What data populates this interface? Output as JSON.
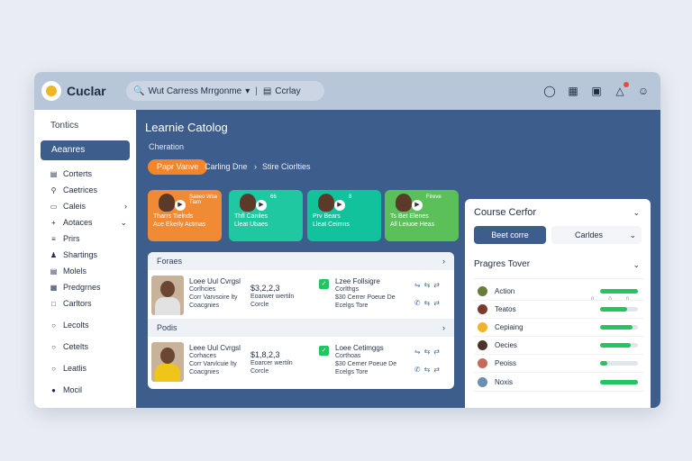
{
  "app": {
    "name": "Cuclar"
  },
  "search": {
    "query": "Wut Carress Mrrgonme",
    "filter": "Ccrlay"
  },
  "top_icons": [
    "user-icon",
    "grid-icon",
    "message-icon",
    "notification-icon",
    "profile-icon"
  ],
  "sidebar": {
    "header": "Tontics",
    "active": "Aeanres",
    "items": [
      {
        "label": "Corterts",
        "icon": "list-icon"
      },
      {
        "label": "Caetrices",
        "icon": "search-icon"
      },
      {
        "label": "Caleis",
        "icon": "box-icon",
        "chevron": true
      },
      {
        "label": "Aotaces",
        "icon": "plus-icon",
        "chevron": true
      },
      {
        "label": "Prirs",
        "icon": "menu-icon"
      },
      {
        "label": "Shartings",
        "icon": "people-icon"
      },
      {
        "label": "Molels",
        "icon": "doc-icon"
      },
      {
        "label": "Predgrnes",
        "icon": "table-icon"
      },
      {
        "label": "Carltors",
        "icon": "square-icon"
      },
      {
        "label": "Lecolts",
        "icon": "circle-icon"
      },
      {
        "label": "Cetelts",
        "icon": "circle-icon"
      },
      {
        "label": "Leatlis",
        "icon": "circle-icon"
      },
      {
        "label": "Mocil",
        "icon": "dot-icon"
      }
    ]
  },
  "main": {
    "title": "Learnie Catolog",
    "subtitle": "Cheration",
    "chips": [
      "Papr Vanve",
      "Carling Dne",
      "Stire Ciorlties"
    ],
    "cards": [
      {
        "title": "Tharrs Tielnds",
        "line2": "Ace Ekerly Actmas",
        "small": "Saeeo Wsa Tiam",
        "color": "#f08a34"
      },
      {
        "title": "Thfl Caniles",
        "line2": "Lleat Ubaes",
        "small": "66",
        "color": "#1fc8a0"
      },
      {
        "title": "Prv Bears",
        "line2": "Lleat Ceimns",
        "small": "8",
        "color": "#12c29d"
      },
      {
        "title": "Ts Bet Elenes",
        "line2": "All Leiuoe Heas",
        "small": "Fireve",
        "color": "#5cc05a"
      }
    ]
  },
  "list": {
    "sections": [
      {
        "header": "Foraes",
        "row": {
          "name": "Loee Uul Cvrgsl",
          "meta1": "Corlhcies",
          "meta2": "Corr Varvsoire lty",
          "meta3": "Coacgnies",
          "num": "$3,2,2,3",
          "nmeta1": "Eoarwer wertiln",
          "nmeta2": "Corcle",
          "course": "Lzee Follsigre",
          "cmeta1": "Corlthgs",
          "cmeta2": "$30 Cerrer Poeue De",
          "cmeta3": "Ecelgs Tore"
        }
      },
      {
        "header": "Podis",
        "row": {
          "name": "Leee Uul Cvrgsl",
          "meta1": "Corhaces",
          "meta2": "Corr Varvlcuie lty",
          "meta3": "Coacgnies",
          "num": "$1,8,2,3",
          "nmeta1": "Eoarcer wertiln",
          "nmeta2": "Corcle",
          "course": "Loee Cetimggs",
          "cmeta1": "Corthoas",
          "cmeta2": "$30 Cerner Poeue De",
          "cmeta3": "Ecelgs Tore"
        }
      }
    ]
  },
  "right_panel": {
    "title": "Course Cerfor",
    "seg_active": "Beet corre",
    "seg_other": "Carldes",
    "progress_title": "Pragres Tover",
    "marks": [
      "0",
      "0",
      "0"
    ],
    "rows": [
      {
        "label": "Action",
        "dot": "#6b7b3a",
        "progress": 1.0
      },
      {
        "label": "Teatos",
        "dot": "#7a3b2e",
        "progress": 0.72
      },
      {
        "label": "Cepiaing",
        "dot": "#f0b429",
        "progress": 0.85
      },
      {
        "label": "Oecies",
        "dot": "#4a3328",
        "progress": 0.8
      },
      {
        "label": "Peoiss",
        "dot": "#c46a5a",
        "progress": 0.18
      },
      {
        "label": "Noxis",
        "dot": "#6a8fb0",
        "progress": 1.0
      }
    ]
  }
}
